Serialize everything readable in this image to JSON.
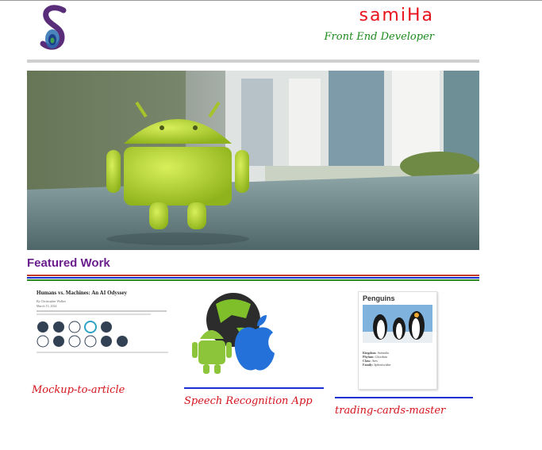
{
  "header": {
    "name": "samiHa",
    "role": "Front End Developer",
    "logo_icon": "peacock-feather-s-logo-icon"
  },
  "hero": {
    "image_icon": "android-robot-hero-photo"
  },
  "featured": {
    "title": "Featured Work",
    "stripe_colors": [
      "#c0392b",
      "#1a2fcf",
      "#2e8b22"
    ],
    "items": [
      {
        "caption": "Mockup-to-article",
        "thumb": {
          "title": "Humans vs. Machines: An AI Odyssey",
          "byline": "By Christopher Walker",
          "date": "March 13, 2024"
        }
      },
      {
        "caption": "Speech Recognition App",
        "thumb_icon": "android-apple-globe-icon"
      },
      {
        "caption": "trading-cards-master",
        "thumb": {
          "title": "Penguins",
          "kingdom_label": "Kingdom:",
          "kingdom": "Animalia",
          "phylum_label": "Phylum:",
          "phylum": "Chordata",
          "class_label": "Class:",
          "class": "Aves",
          "family_label": "Family:",
          "family": "Spheniscidae"
        }
      }
    ]
  }
}
